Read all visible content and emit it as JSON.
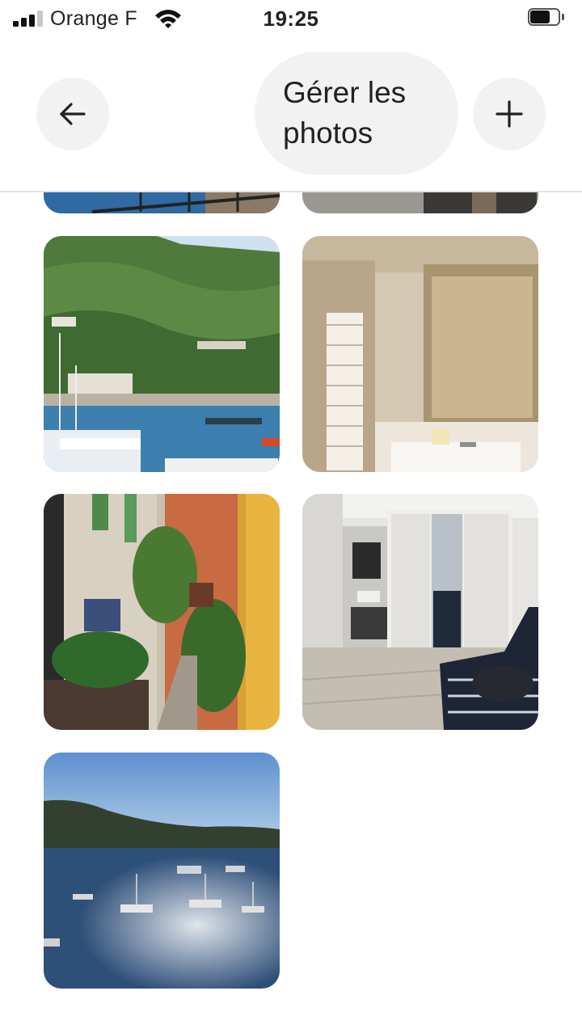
{
  "status_bar": {
    "carrier": "Orange F",
    "time": "19:25",
    "signal_bars_active": 3,
    "signal_bars_total": 4,
    "battery_level": 0.75
  },
  "header": {
    "title": "Gérer les photos",
    "back_icon": "arrow-left-icon",
    "add_icon": "plus-icon"
  },
  "photos": [
    {
      "subject": "sea-balcony-view"
    },
    {
      "subject": "interior-partial"
    },
    {
      "subject": "harbor-with-hillside"
    },
    {
      "subject": "bathroom-with-mirror"
    },
    {
      "subject": "old-town-alley"
    },
    {
      "subject": "bedroom-with-wardrobe"
    },
    {
      "subject": "bay-with-boats"
    }
  ],
  "colors": {
    "button_background": "#f2f2f2",
    "divider": "#e2e2e2",
    "text": "#222222"
  }
}
